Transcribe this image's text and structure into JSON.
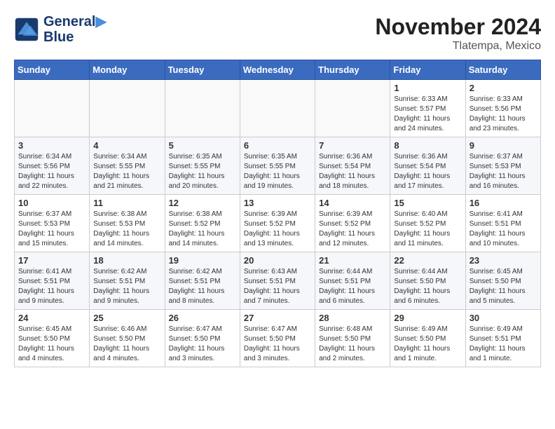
{
  "header": {
    "logo_line1": "General",
    "logo_line2": "Blue",
    "month": "November 2024",
    "location": "Tlatempa, Mexico"
  },
  "weekdays": [
    "Sunday",
    "Monday",
    "Tuesday",
    "Wednesday",
    "Thursday",
    "Friday",
    "Saturday"
  ],
  "weeks": [
    [
      {
        "day": "",
        "info": ""
      },
      {
        "day": "",
        "info": ""
      },
      {
        "day": "",
        "info": ""
      },
      {
        "day": "",
        "info": ""
      },
      {
        "day": "",
        "info": ""
      },
      {
        "day": "1",
        "info": "Sunrise: 6:33 AM\nSunset: 5:57 PM\nDaylight: 11 hours\nand 24 minutes."
      },
      {
        "day": "2",
        "info": "Sunrise: 6:33 AM\nSunset: 5:56 PM\nDaylight: 11 hours\nand 23 minutes."
      }
    ],
    [
      {
        "day": "3",
        "info": "Sunrise: 6:34 AM\nSunset: 5:56 PM\nDaylight: 11 hours\nand 22 minutes."
      },
      {
        "day": "4",
        "info": "Sunrise: 6:34 AM\nSunset: 5:55 PM\nDaylight: 11 hours\nand 21 minutes."
      },
      {
        "day": "5",
        "info": "Sunrise: 6:35 AM\nSunset: 5:55 PM\nDaylight: 11 hours\nand 20 minutes."
      },
      {
        "day": "6",
        "info": "Sunrise: 6:35 AM\nSunset: 5:55 PM\nDaylight: 11 hours\nand 19 minutes."
      },
      {
        "day": "7",
        "info": "Sunrise: 6:36 AM\nSunset: 5:54 PM\nDaylight: 11 hours\nand 18 minutes."
      },
      {
        "day": "8",
        "info": "Sunrise: 6:36 AM\nSunset: 5:54 PM\nDaylight: 11 hours\nand 17 minutes."
      },
      {
        "day": "9",
        "info": "Sunrise: 6:37 AM\nSunset: 5:53 PM\nDaylight: 11 hours\nand 16 minutes."
      }
    ],
    [
      {
        "day": "10",
        "info": "Sunrise: 6:37 AM\nSunset: 5:53 PM\nDaylight: 11 hours\nand 15 minutes."
      },
      {
        "day": "11",
        "info": "Sunrise: 6:38 AM\nSunset: 5:53 PM\nDaylight: 11 hours\nand 14 minutes."
      },
      {
        "day": "12",
        "info": "Sunrise: 6:38 AM\nSunset: 5:52 PM\nDaylight: 11 hours\nand 14 minutes."
      },
      {
        "day": "13",
        "info": "Sunrise: 6:39 AM\nSunset: 5:52 PM\nDaylight: 11 hours\nand 13 minutes."
      },
      {
        "day": "14",
        "info": "Sunrise: 6:39 AM\nSunset: 5:52 PM\nDaylight: 11 hours\nand 12 minutes."
      },
      {
        "day": "15",
        "info": "Sunrise: 6:40 AM\nSunset: 5:52 PM\nDaylight: 11 hours\nand 11 minutes."
      },
      {
        "day": "16",
        "info": "Sunrise: 6:41 AM\nSunset: 5:51 PM\nDaylight: 11 hours\nand 10 minutes."
      }
    ],
    [
      {
        "day": "17",
        "info": "Sunrise: 6:41 AM\nSunset: 5:51 PM\nDaylight: 11 hours\nand 9 minutes."
      },
      {
        "day": "18",
        "info": "Sunrise: 6:42 AM\nSunset: 5:51 PM\nDaylight: 11 hours\nand 9 minutes."
      },
      {
        "day": "19",
        "info": "Sunrise: 6:42 AM\nSunset: 5:51 PM\nDaylight: 11 hours\nand 8 minutes."
      },
      {
        "day": "20",
        "info": "Sunrise: 6:43 AM\nSunset: 5:51 PM\nDaylight: 11 hours\nand 7 minutes."
      },
      {
        "day": "21",
        "info": "Sunrise: 6:44 AM\nSunset: 5:51 PM\nDaylight: 11 hours\nand 6 minutes."
      },
      {
        "day": "22",
        "info": "Sunrise: 6:44 AM\nSunset: 5:50 PM\nDaylight: 11 hours\nand 6 minutes."
      },
      {
        "day": "23",
        "info": "Sunrise: 6:45 AM\nSunset: 5:50 PM\nDaylight: 11 hours\nand 5 minutes."
      }
    ],
    [
      {
        "day": "24",
        "info": "Sunrise: 6:45 AM\nSunset: 5:50 PM\nDaylight: 11 hours\nand 4 minutes."
      },
      {
        "day": "25",
        "info": "Sunrise: 6:46 AM\nSunset: 5:50 PM\nDaylight: 11 hours\nand 4 minutes."
      },
      {
        "day": "26",
        "info": "Sunrise: 6:47 AM\nSunset: 5:50 PM\nDaylight: 11 hours\nand 3 minutes."
      },
      {
        "day": "27",
        "info": "Sunrise: 6:47 AM\nSunset: 5:50 PM\nDaylight: 11 hours\nand 3 minutes."
      },
      {
        "day": "28",
        "info": "Sunrise: 6:48 AM\nSunset: 5:50 PM\nDaylight: 11 hours\nand 2 minutes."
      },
      {
        "day": "29",
        "info": "Sunrise: 6:49 AM\nSunset: 5:50 PM\nDaylight: 11 hours\nand 1 minute."
      },
      {
        "day": "30",
        "info": "Sunrise: 6:49 AM\nSunset: 5:51 PM\nDaylight: 11 hours\nand 1 minute."
      }
    ]
  ]
}
